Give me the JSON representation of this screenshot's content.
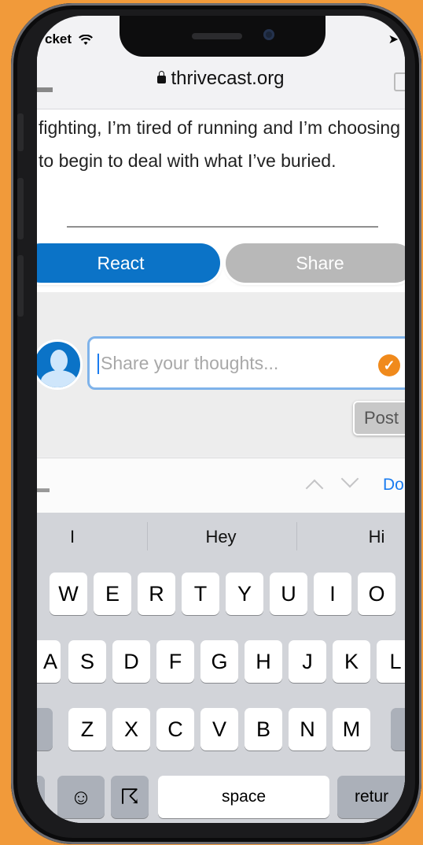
{
  "status": {
    "app": "cket",
    "right_glyph": "➤"
  },
  "browser": {
    "domain": "thrivecast.org"
  },
  "article": {
    "text": "fighting, I’m tired of running and I’m choosing to begin to deal with what I’ve buried."
  },
  "actions": {
    "react": "React",
    "share": "Share"
  },
  "comment": {
    "placeholder": "Share your thoughts...",
    "post": "Post"
  },
  "keyboard_toolbar": {
    "done": "Do"
  },
  "keyboard": {
    "suggestions": [
      "I",
      "Hey",
      "Hi"
    ],
    "row1": [
      "W",
      "E",
      "R",
      "T",
      "Y",
      "U",
      "I",
      "O"
    ],
    "row2": [
      "A",
      "S",
      "D",
      "F",
      "G",
      "H",
      "J",
      "K",
      "L"
    ],
    "row3": [
      "Z",
      "X",
      "C",
      "V",
      "B",
      "N",
      "M"
    ],
    "space": "space",
    "return": "retur",
    "emoji_glyph": "☺",
    "mic_glyph": "☈"
  },
  "colors": {
    "accent": "#0b73c7",
    "background": "#f19a3a",
    "check": "#f08a1c"
  }
}
